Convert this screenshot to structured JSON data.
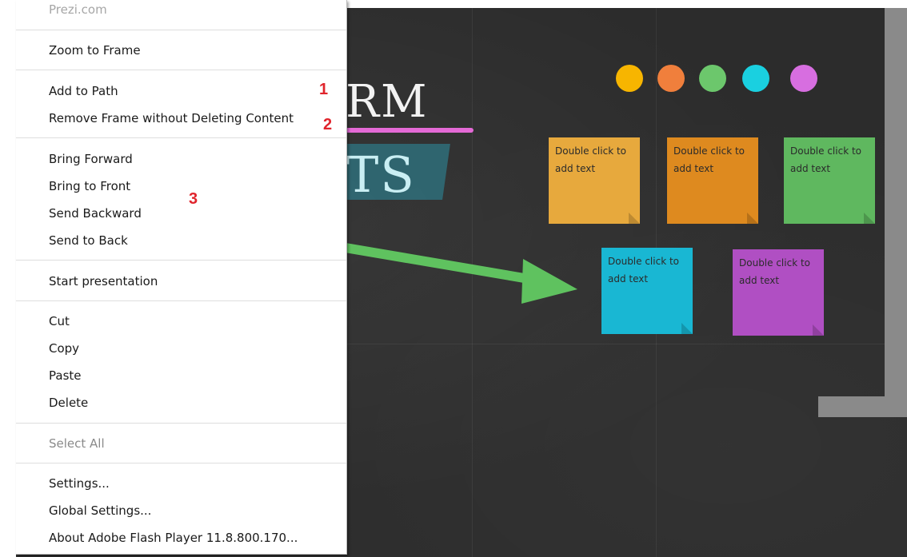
{
  "menu": {
    "header": "Prezi.com",
    "zoom_to_frame": "Zoom to Frame",
    "add_to_path": "Add to Path",
    "remove_frame": "Remove Frame without Deleting Content",
    "bring_forward": "Bring Forward",
    "bring_to_front": "Bring to Front",
    "send_backward": "Send Backward",
    "send_to_back": "Send to Back",
    "start_presentation": "Start presentation",
    "cut": "Cut",
    "copy": "Copy",
    "paste": "Paste",
    "delete": "Delete",
    "select_all": "Select All",
    "settings": "Settings...",
    "global_settings": "Global Settings...",
    "about": "About Adobe Flash Player 11.8.800.170..."
  },
  "annotations": {
    "one": "1",
    "two": "2",
    "three": "3"
  },
  "canvas": {
    "title_line1": "RM",
    "title_line2": "TS",
    "dot_colors": [
      "#f7b500",
      "#f07f3c",
      "#6cc76c",
      "#1ad0e0",
      "#d76ee0"
    ],
    "notes": [
      {
        "text": "Double click to add text",
        "color": "#e7a93d"
      },
      {
        "text": "Double click to add text",
        "color": "#de8a1f"
      },
      {
        "text": "Double click to add text",
        "color": "#5fb85f"
      },
      {
        "text": "Double click to add text",
        "color": "#19b7d3"
      },
      {
        "text": "Double click to add text",
        "color": "#b04fc3"
      }
    ],
    "arrow_color": "#5fc25f",
    "accent_underline": "#e46ad6",
    "annotation_color": "#e0242c"
  }
}
